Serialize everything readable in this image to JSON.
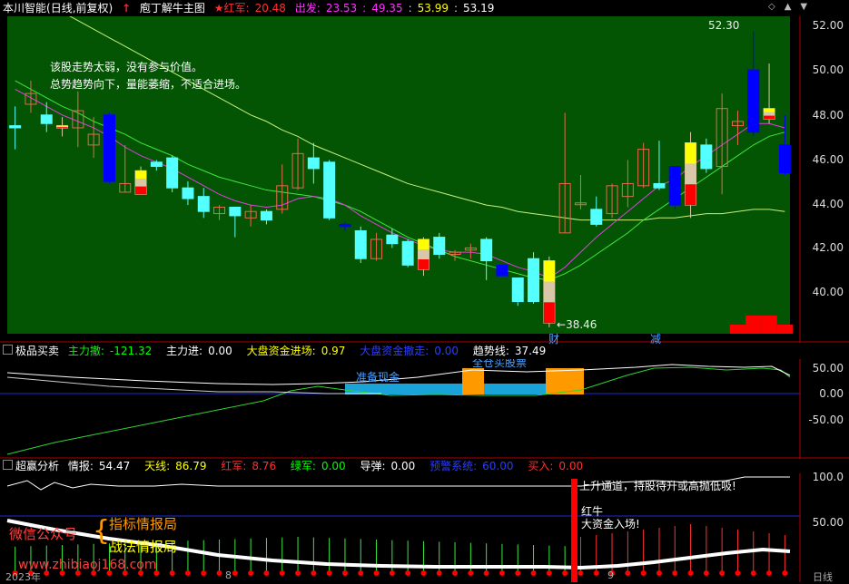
{
  "colors": {
    "panel1_bg": "#035403",
    "up": "#e56a4b",
    "down": "#54ffff",
    "strong_down": "#0000ff",
    "red": "#ff0000",
    "yellow": "#ffff00",
    "orange": "#ff9900",
    "cyan_bar": "#1aa3d9",
    "green_text": "#00ff00",
    "grid_red": "#b00000"
  },
  "header1": {
    "stock": "本川智能",
    "period": "(日线,前复权)",
    "indicator": "庖丁解牛主图",
    "hongjun_label": "★红军:",
    "hongjun_value": "20.48",
    "chufa_label": "出发:",
    "chufa_value": "23.53",
    "v1": "49.35",
    "v2": "53.99",
    "v3": "53.19",
    "arrow_icon": "red-up-arrow-icon",
    "sep1": ":",
    "sep2": ":",
    "sep3": ":"
  },
  "main_notes": {
    "line1": "该股走势太弱，没有参与价值。",
    "line2": "总势趋势向下，量能萎缩，不适合进场。",
    "high_label": "52.30",
    "low_label": "38.46",
    "low_arrow": "←",
    "cai_mark": "财",
    "jian_mark": "减"
  },
  "main_axis": [
    "52.00",
    "50.00",
    "48.00",
    "46.00",
    "44.00",
    "42.00",
    "40.00"
  ],
  "header2": {
    "name": "极品买卖",
    "zlc_label": "主力撤:",
    "zlc_value": "-121.32",
    "zlj_label": "主力进:",
    "zlj_value": "0.00",
    "dp_label": "大盘资金进场:",
    "dp_value": "0.97",
    "dpt_label": "大盘资金撤走:",
    "dpt_value": "0.00",
    "qs_label": "趋势线:",
    "qs_value": "37.49"
  },
  "panel2_notes": {
    "ready_cash": "准备现金",
    "buy_stock": "全仓买股票"
  },
  "panel2_axis": [
    "50.00",
    "0.00",
    "-50.00"
  ],
  "header3": {
    "name": "超赢分析",
    "qb_label": "情报:",
    "qb_value": "54.47",
    "tx_label": "天线:",
    "tx_value": "86.79",
    "hj_label": "红军:",
    "hj_value": "8.76",
    "lj_label": "绿军:",
    "lj_value": "0.00",
    "dd_label": "导弹:",
    "dd_value": "0.00",
    "yj_label": "预警系统:",
    "yj_value": "60.00",
    "mr_label": "买入:",
    "mr_value": "0.00"
  },
  "panel3_notes": {
    "up_channel": "上升通道，持股待升或高抛低吸!",
    "hongniu": "红牛",
    "fund_in": "大资金入场!"
  },
  "panel3_axis": [
    "100.0",
    "50.00"
  ],
  "watermark": {
    "wechat": "微信公众号",
    "brace": "{",
    "line1": "指标情报局",
    "line2": "战法情报局",
    "url": "www.zhibiaoj168.com"
  },
  "date_axis": {
    "year": "2023年",
    "m1": "8",
    "m2": "9",
    "period_label": "日线"
  },
  "window_controls": {
    "diamond": "diamond-icon",
    "up": "up-triangle-icon",
    "down": "down-triangle-icon",
    "diamond_glyph": "◇",
    "up_glyph": "▲",
    "down_glyph": "▼"
  },
  "chart_data": {
    "type": "candlestick",
    "ylim": [
      38.2,
      53.0
    ],
    "candles": [
      {
        "o": 47.9,
        "h": 48.8,
        "l": 46.8,
        "c": 47.8,
        "col": "down"
      },
      {
        "o": 48.9,
        "h": 50.0,
        "l": 48.5,
        "c": 49.4,
        "col": "up"
      },
      {
        "o": 48.4,
        "h": 49.0,
        "l": 47.6,
        "c": 48.0,
        "col": "down"
      },
      {
        "o": 47.8,
        "h": 48.3,
        "l": 47.4,
        "c": 47.9,
        "col": "sig"
      },
      {
        "o": 47.8,
        "h": 49.5,
        "l": 46.9,
        "c": 48.6,
        "col": "up"
      },
      {
        "o": 47.5,
        "h": 48.3,
        "l": 46.4,
        "c": 47.0,
        "col": "up"
      },
      {
        "o": 48.4,
        "h": 48.5,
        "l": 45.2,
        "c": 45.3,
        "col": "strong"
      },
      {
        "o": 44.8,
        "h": 47.0,
        "l": 44.8,
        "c": 45.2,
        "col": "up"
      },
      {
        "o": 44.7,
        "h": 46.0,
        "l": 44.7,
        "c": 45.8,
        "col": "sig"
      },
      {
        "o": 46.0,
        "h": 46.3,
        "l": 45.8,
        "c": 46.2,
        "col": "down"
      },
      {
        "o": 46.4,
        "h": 46.5,
        "l": 44.8,
        "c": 45.0,
        "col": "down"
      },
      {
        "o": 45.0,
        "h": 45.3,
        "l": 44.2,
        "c": 44.5,
        "col": "down"
      },
      {
        "o": 44.6,
        "h": 45.0,
        "l": 43.6,
        "c": 43.9,
        "col": "down"
      },
      {
        "o": 43.8,
        "h": 44.2,
        "l": 43.5,
        "c": 44.1,
        "col": "up"
      },
      {
        "o": 44.1,
        "h": 44.1,
        "l": 42.7,
        "c": 43.7,
        "col": "down"
      },
      {
        "o": 43.6,
        "h": 44.2,
        "l": 43.2,
        "c": 43.9,
        "col": "up"
      },
      {
        "o": 43.9,
        "h": 44.0,
        "l": 43.3,
        "c": 43.5,
        "col": "down"
      },
      {
        "o": 44.0,
        "h": 46.1,
        "l": 43.8,
        "c": 45.1,
        "col": "up"
      },
      {
        "o": 45.0,
        "h": 47.3,
        "l": 44.9,
        "c": 46.6,
        "col": "up"
      },
      {
        "o": 46.4,
        "h": 47.1,
        "l": 45.2,
        "c": 45.9,
        "col": "down"
      },
      {
        "o": 46.2,
        "h": 46.3,
        "l": 43.5,
        "c": 43.6,
        "col": "down"
      },
      {
        "o": 43.3,
        "h": 43.4,
        "l": 43.0,
        "c": 43.2,
        "col": "strong"
      },
      {
        "o": 43.0,
        "h": 43.2,
        "l": 41.5,
        "c": 41.7,
        "col": "down"
      },
      {
        "o": 41.7,
        "h": 42.9,
        "l": 41.6,
        "c": 42.6,
        "col": "up"
      },
      {
        "o": 42.8,
        "h": 43.1,
        "l": 42.2,
        "c": 42.4,
        "col": "down"
      },
      {
        "o": 42.5,
        "h": 42.6,
        "l": 41.3,
        "c": 41.4,
        "col": "down"
      },
      {
        "o": 41.2,
        "h": 42.7,
        "l": 40.9,
        "c": 42.6,
        "col": "sig"
      },
      {
        "o": 42.7,
        "h": 42.9,
        "l": 41.7,
        "c": 41.9,
        "col": "down"
      },
      {
        "o": 41.9,
        "h": 42.1,
        "l": 41.6,
        "c": 42.0,
        "col": "up"
      },
      {
        "o": 42.1,
        "h": 42.4,
        "l": 41.7,
        "c": 42.2,
        "col": "up"
      },
      {
        "o": 42.6,
        "h": 42.7,
        "l": 40.7,
        "c": 41.6,
        "col": "down"
      },
      {
        "o": 41.4,
        "h": 41.4,
        "l": 40.9,
        "c": 40.9,
        "col": "strong"
      },
      {
        "o": 40.8,
        "h": 40.8,
        "l": 39.5,
        "c": 39.7,
        "col": "down"
      },
      {
        "o": 41.7,
        "h": 42.0,
        "l": 39.6,
        "c": 39.7,
        "col": "down"
      },
      {
        "o": 38.7,
        "h": 41.8,
        "l": 38.5,
        "c": 41.6,
        "col": "sig"
      },
      {
        "o": 42.9,
        "h": 48.5,
        "l": 42.9,
        "c": 45.2,
        "col": "up"
      },
      {
        "o": 44.3,
        "h": 45.6,
        "l": 44.0,
        "c": 44.3,
        "col": "up"
      },
      {
        "o": 43.3,
        "h": 44.6,
        "l": 43.2,
        "c": 44.0,
        "col": "down"
      },
      {
        "o": 43.8,
        "h": 45.2,
        "l": 43.6,
        "c": 45.1,
        "col": "up"
      },
      {
        "o": 44.6,
        "h": 46.3,
        "l": 44.1,
        "c": 45.2,
        "col": "up"
      },
      {
        "o": 45.1,
        "h": 47.1,
        "l": 45.0,
        "c": 46.8,
        "col": "up"
      },
      {
        "o": 45.2,
        "h": 47.2,
        "l": 44.9,
        "c": 45.0,
        "col": "down"
      },
      {
        "o": 44.2,
        "h": 46.0,
        "l": 44.0,
        "c": 46.0,
        "col": "strong"
      },
      {
        "o": 44.2,
        "h": 47.6,
        "l": 43.6,
        "c": 47.1,
        "col": "sig"
      },
      {
        "o": 45.9,
        "h": 47.3,
        "l": 45.7,
        "c": 47.0,
        "col": "down"
      },
      {
        "o": 46.0,
        "h": 49.4,
        "l": 44.7,
        "c": 48.7,
        "col": "up"
      },
      {
        "o": 47.9,
        "h": 48.6,
        "l": 47.0,
        "c": 48.1,
        "col": "up"
      },
      {
        "o": 50.5,
        "h": 52.3,
        "l": 47.4,
        "c": 47.6,
        "col": "strong"
      },
      {
        "o": 48.2,
        "h": 50.8,
        "l": 48.0,
        "c": 48.7,
        "col": "sig2"
      },
      {
        "o": 47.0,
        "h": 48.4,
        "l": 45.6,
        "c": 45.7,
        "col": "strong"
      }
    ],
    "ma_magenta": [
      49.6,
      49.2,
      48.8,
      48.4,
      48.1,
      47.8,
      47.4,
      46.9,
      46.5,
      46.2,
      45.9,
      45.5,
      45.1,
      44.7,
      44.4,
      44.2,
      44.1,
      44.2,
      44.5,
      44.6,
      44.5,
      44.2,
      43.7,
      43.3,
      42.9,
      42.6,
      42.3,
      42.1,
      42.0,
      42.0,
      41.9,
      41.6,
      41.3,
      41.1,
      40.8,
      41.3,
      42.0,
      42.7,
      43.3,
      43.9,
      44.5,
      45.1,
      45.4,
      46.0,
      46.5,
      47.0,
      47.5,
      48.0,
      48.0,
      47.8
    ],
    "ma_green": [
      50.0,
      49.6,
      49.2,
      48.8,
      48.5,
      48.1,
      47.8,
      47.5,
      47.1,
      46.8,
      46.5,
      46.1,
      45.8,
      45.5,
      45.3,
      45.1,
      44.9,
      44.8,
      44.7,
      44.6,
      44.4,
      44.2,
      43.9,
      43.5,
      43.1,
      42.7,
      42.4,
      42.1,
      41.8,
      41.6,
      41.4,
      41.2,
      41.0,
      40.8,
      40.7,
      41.0,
      41.4,
      41.9,
      42.4,
      42.9,
      43.5,
      44.0,
      44.5,
      45.0,
      45.5,
      46.0,
      46.5,
      47.0,
      47.4,
      47.6
    ],
    "ma_yellow": [
      54.3,
      54.0,
      53.6,
      53.2,
      52.8,
      52.4,
      52.0,
      51.6,
      51.2,
      50.8,
      50.4,
      50.0,
      49.6,
      49.2,
      48.8,
      48.4,
      48.1,
      47.7,
      47.4,
      47.0,
      46.7,
      46.4,
      46.1,
      45.8,
      45.5,
      45.2,
      45.0,
      44.8,
      44.6,
      44.4,
      44.2,
      44.1,
      43.9,
      43.8,
      43.7,
      43.6,
      43.5,
      43.5,
      43.5,
      43.5,
      43.5,
      43.6,
      43.6,
      43.7,
      43.8,
      43.8,
      43.9,
      44.0,
      44.0,
      43.9
    ],
    "volume_red": [
      0,
      0,
      0,
      0,
      0,
      0,
      0,
      0,
      0,
      0,
      0,
      0,
      0,
      0,
      0,
      0,
      0,
      0,
      0,
      0,
      0,
      0,
      0,
      0,
      0,
      0,
      0,
      0,
      0,
      0,
      0,
      0,
      0,
      0,
      0,
      0,
      0,
      0,
      0,
      0,
      0,
      0,
      0,
      0,
      0,
      0,
      1,
      2,
      2,
      1
    ]
  }
}
